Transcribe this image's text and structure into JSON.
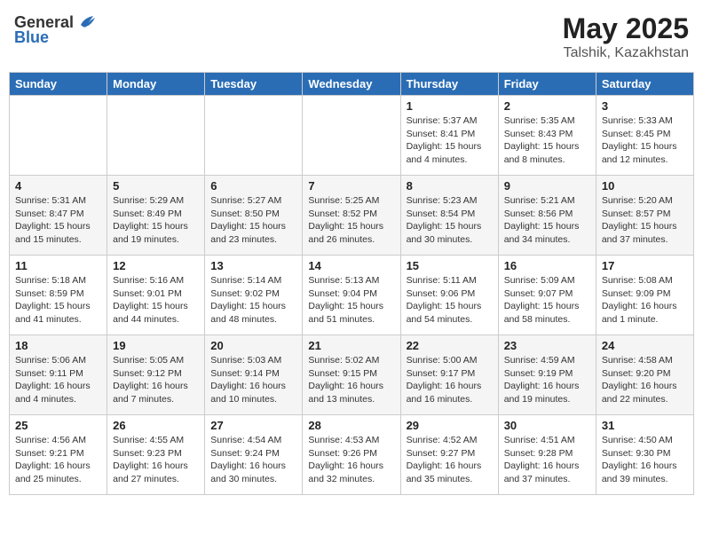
{
  "header": {
    "logo_general": "General",
    "logo_blue": "Blue",
    "month_year": "May 2025",
    "location": "Talshik, Kazakhstan"
  },
  "days_of_week": [
    "Sunday",
    "Monday",
    "Tuesday",
    "Wednesday",
    "Thursday",
    "Friday",
    "Saturday"
  ],
  "weeks": [
    [
      {
        "day": "",
        "info": ""
      },
      {
        "day": "",
        "info": ""
      },
      {
        "day": "",
        "info": ""
      },
      {
        "day": "",
        "info": ""
      },
      {
        "day": "1",
        "info": "Sunrise: 5:37 AM\nSunset: 8:41 PM\nDaylight: 15 hours\nand 4 minutes."
      },
      {
        "day": "2",
        "info": "Sunrise: 5:35 AM\nSunset: 8:43 PM\nDaylight: 15 hours\nand 8 minutes."
      },
      {
        "day": "3",
        "info": "Sunrise: 5:33 AM\nSunset: 8:45 PM\nDaylight: 15 hours\nand 12 minutes."
      }
    ],
    [
      {
        "day": "4",
        "info": "Sunrise: 5:31 AM\nSunset: 8:47 PM\nDaylight: 15 hours\nand 15 minutes."
      },
      {
        "day": "5",
        "info": "Sunrise: 5:29 AM\nSunset: 8:49 PM\nDaylight: 15 hours\nand 19 minutes."
      },
      {
        "day": "6",
        "info": "Sunrise: 5:27 AM\nSunset: 8:50 PM\nDaylight: 15 hours\nand 23 minutes."
      },
      {
        "day": "7",
        "info": "Sunrise: 5:25 AM\nSunset: 8:52 PM\nDaylight: 15 hours\nand 26 minutes."
      },
      {
        "day": "8",
        "info": "Sunrise: 5:23 AM\nSunset: 8:54 PM\nDaylight: 15 hours\nand 30 minutes."
      },
      {
        "day": "9",
        "info": "Sunrise: 5:21 AM\nSunset: 8:56 PM\nDaylight: 15 hours\nand 34 minutes."
      },
      {
        "day": "10",
        "info": "Sunrise: 5:20 AM\nSunset: 8:57 PM\nDaylight: 15 hours\nand 37 minutes."
      }
    ],
    [
      {
        "day": "11",
        "info": "Sunrise: 5:18 AM\nSunset: 8:59 PM\nDaylight: 15 hours\nand 41 minutes."
      },
      {
        "day": "12",
        "info": "Sunrise: 5:16 AM\nSunset: 9:01 PM\nDaylight: 15 hours\nand 44 minutes."
      },
      {
        "day": "13",
        "info": "Sunrise: 5:14 AM\nSunset: 9:02 PM\nDaylight: 15 hours\nand 48 minutes."
      },
      {
        "day": "14",
        "info": "Sunrise: 5:13 AM\nSunset: 9:04 PM\nDaylight: 15 hours\nand 51 minutes."
      },
      {
        "day": "15",
        "info": "Sunrise: 5:11 AM\nSunset: 9:06 PM\nDaylight: 15 hours\nand 54 minutes."
      },
      {
        "day": "16",
        "info": "Sunrise: 5:09 AM\nSunset: 9:07 PM\nDaylight: 15 hours\nand 58 minutes."
      },
      {
        "day": "17",
        "info": "Sunrise: 5:08 AM\nSunset: 9:09 PM\nDaylight: 16 hours\nand 1 minute."
      }
    ],
    [
      {
        "day": "18",
        "info": "Sunrise: 5:06 AM\nSunset: 9:11 PM\nDaylight: 16 hours\nand 4 minutes."
      },
      {
        "day": "19",
        "info": "Sunrise: 5:05 AM\nSunset: 9:12 PM\nDaylight: 16 hours\nand 7 minutes."
      },
      {
        "day": "20",
        "info": "Sunrise: 5:03 AM\nSunset: 9:14 PM\nDaylight: 16 hours\nand 10 minutes."
      },
      {
        "day": "21",
        "info": "Sunrise: 5:02 AM\nSunset: 9:15 PM\nDaylight: 16 hours\nand 13 minutes."
      },
      {
        "day": "22",
        "info": "Sunrise: 5:00 AM\nSunset: 9:17 PM\nDaylight: 16 hours\nand 16 minutes."
      },
      {
        "day": "23",
        "info": "Sunrise: 4:59 AM\nSunset: 9:19 PM\nDaylight: 16 hours\nand 19 minutes."
      },
      {
        "day": "24",
        "info": "Sunrise: 4:58 AM\nSunset: 9:20 PM\nDaylight: 16 hours\nand 22 minutes."
      }
    ],
    [
      {
        "day": "25",
        "info": "Sunrise: 4:56 AM\nSunset: 9:21 PM\nDaylight: 16 hours\nand 25 minutes."
      },
      {
        "day": "26",
        "info": "Sunrise: 4:55 AM\nSunset: 9:23 PM\nDaylight: 16 hours\nand 27 minutes."
      },
      {
        "day": "27",
        "info": "Sunrise: 4:54 AM\nSunset: 9:24 PM\nDaylight: 16 hours\nand 30 minutes."
      },
      {
        "day": "28",
        "info": "Sunrise: 4:53 AM\nSunset: 9:26 PM\nDaylight: 16 hours\nand 32 minutes."
      },
      {
        "day": "29",
        "info": "Sunrise: 4:52 AM\nSunset: 9:27 PM\nDaylight: 16 hours\nand 35 minutes."
      },
      {
        "day": "30",
        "info": "Sunrise: 4:51 AM\nSunset: 9:28 PM\nDaylight: 16 hours\nand 37 minutes."
      },
      {
        "day": "31",
        "info": "Sunrise: 4:50 AM\nSunset: 9:30 PM\nDaylight: 16 hours\nand 39 minutes."
      }
    ]
  ]
}
